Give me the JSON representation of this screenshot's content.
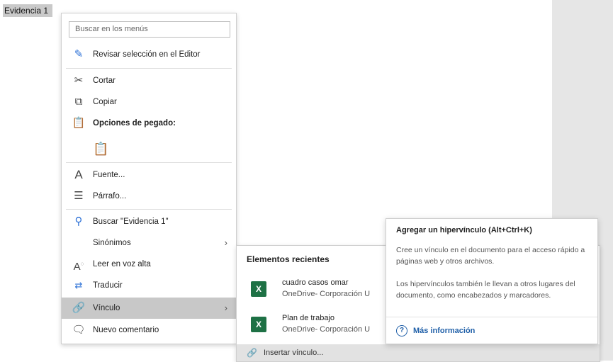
{
  "document": {
    "selected_text": "Evidencia 1"
  },
  "context_menu": {
    "search_placeholder": "Buscar en los menús",
    "items": [
      {
        "label": "Revisar selección en el Editor",
        "icon": "editor-pen-icon"
      },
      {
        "label": "Cortar",
        "icon": "scissors-icon"
      },
      {
        "label": "Copiar",
        "icon": "copy-icon"
      },
      {
        "label": "Opciones de pegado:",
        "icon": "paste-icon"
      },
      {
        "label": "Fuente...",
        "icon": "font-icon"
      },
      {
        "label": "Párrafo...",
        "icon": "paragraph-icon"
      },
      {
        "label": "Buscar \"Evidencia 1\"",
        "icon": "search-icon"
      },
      {
        "label": "Sinónimos",
        "icon": ""
      },
      {
        "label": "Leer en voz alta",
        "icon": "read-aloud-icon"
      },
      {
        "label": "Traducir",
        "icon": "translate-icon"
      },
      {
        "label": "Vínculo",
        "icon": "link-icon"
      },
      {
        "label": "Nuevo comentario",
        "icon": "comment-icon"
      }
    ]
  },
  "submenu": {
    "title": "Elementos recientes",
    "recent": [
      {
        "name": "cuadro casos omar",
        "path": "OneDrive- Corporación U"
      },
      {
        "name": "Plan de trabajo",
        "path": "OneDrive- Corporación U"
      }
    ],
    "insert_label": "Insertar vínculo..."
  },
  "tooltip": {
    "title": "Agregar un hipervínculo (Alt+Ctrl+K)",
    "paragraph1": "Cree un vínculo en el documento para el acceso rápido a páginas web y otros archivos.",
    "paragraph2": "Los hipervínculos también le llevan a otros lugares del documento, como encabezados y marcadores.",
    "more_label": "Más información"
  },
  "colors": {
    "excel_green": "#1e7145",
    "link_blue": "#1f5fa8",
    "highlight": "#c8c8c8"
  }
}
